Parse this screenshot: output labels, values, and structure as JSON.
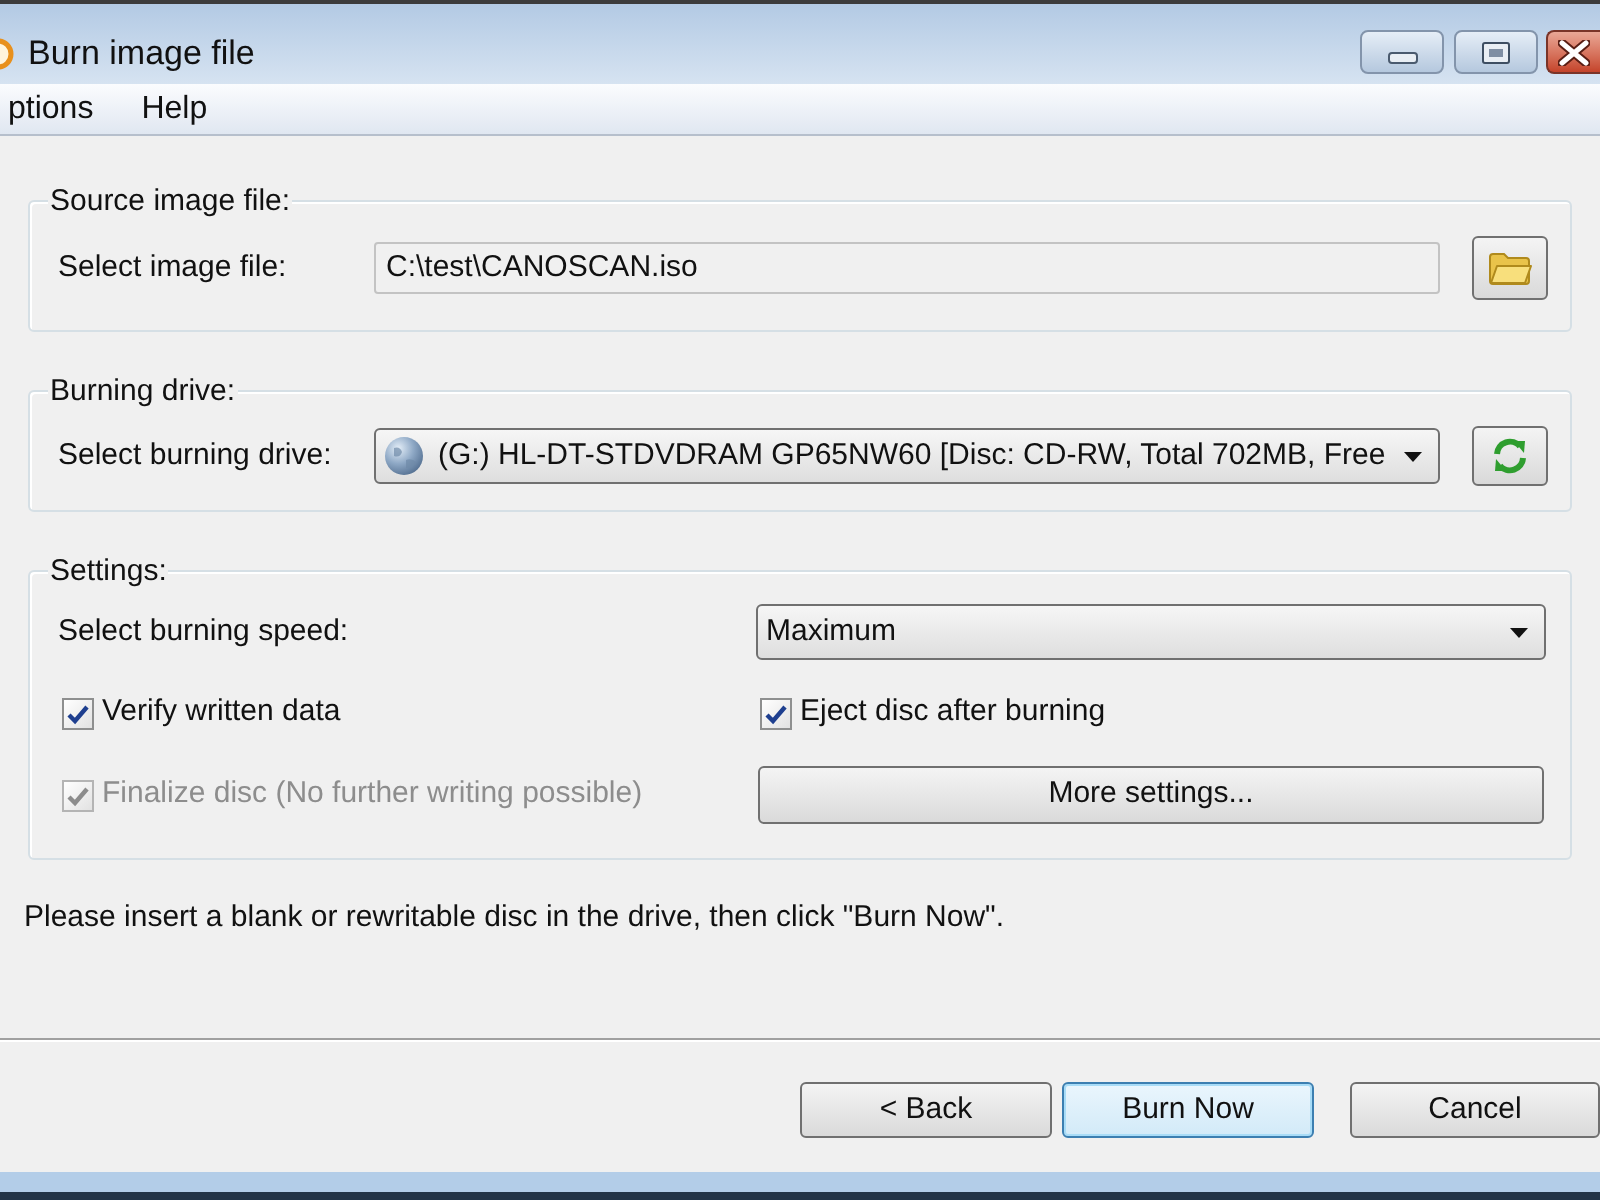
{
  "window": {
    "title": "Burn image file"
  },
  "menu": [
    {
      "label": "ptions"
    },
    {
      "label": "Help"
    }
  ],
  "source": {
    "legend": "Source image file:",
    "label": "Select image file:",
    "value": "C:\\test\\CANOSCAN.iso"
  },
  "drive": {
    "legend": "Burning drive:",
    "label": "Select burning drive:",
    "value": "(G:) HL-DT-STDVDRAM GP65NW60 [Disc: CD-RW, Total 702MB, Free"
  },
  "settings": {
    "legend": "Settings:",
    "speed_label": "Select burning speed:",
    "speed_value": "Maximum",
    "options": [
      {
        "label": "Verify written data",
        "checked": true,
        "disabled": false
      },
      {
        "label": "Eject disc after burning",
        "checked": true,
        "disabled": false
      },
      {
        "label": "Finalize disc (No further writing possible)",
        "checked": true,
        "disabled": true
      }
    ],
    "more_button": "More settings..."
  },
  "message": "Please insert a blank or rewritable disc in the drive, then click \"Burn Now\".",
  "buttons": [
    {
      "label": "< Back",
      "default": false
    },
    {
      "label": "Burn Now",
      "default": true
    },
    {
      "label": "Cancel",
      "default": false
    }
  ]
}
